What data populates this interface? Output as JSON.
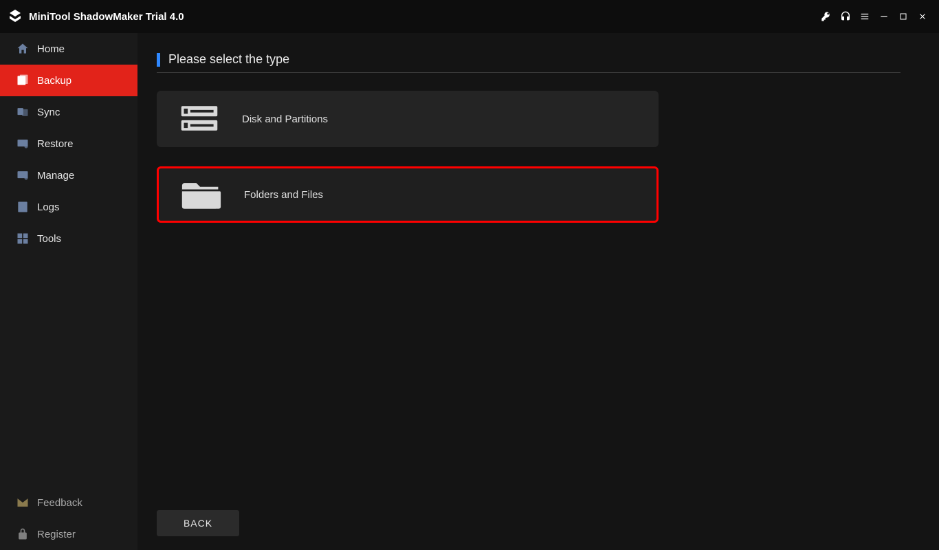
{
  "titlebar": {
    "app_name": "MiniTool ShadowMaker Trial 4.0"
  },
  "sidebar": {
    "items": [
      {
        "label": "Home",
        "icon": "home"
      },
      {
        "label": "Backup",
        "icon": "backup",
        "active": true
      },
      {
        "label": "Sync",
        "icon": "sync"
      },
      {
        "label": "Restore",
        "icon": "restore"
      },
      {
        "label": "Manage",
        "icon": "manage"
      },
      {
        "label": "Logs",
        "icon": "logs"
      },
      {
        "label": "Tools",
        "icon": "tools"
      }
    ],
    "bottom": [
      {
        "label": "Feedback",
        "icon": "feedback"
      },
      {
        "label": "Register",
        "icon": "register"
      }
    ]
  },
  "main": {
    "title": "Please select the type",
    "options": [
      {
        "label": "Disk and Partitions",
        "icon": "disk"
      },
      {
        "label": "Folders and Files",
        "icon": "folder",
        "highlighted": true
      }
    ],
    "back_label": "BACK"
  }
}
